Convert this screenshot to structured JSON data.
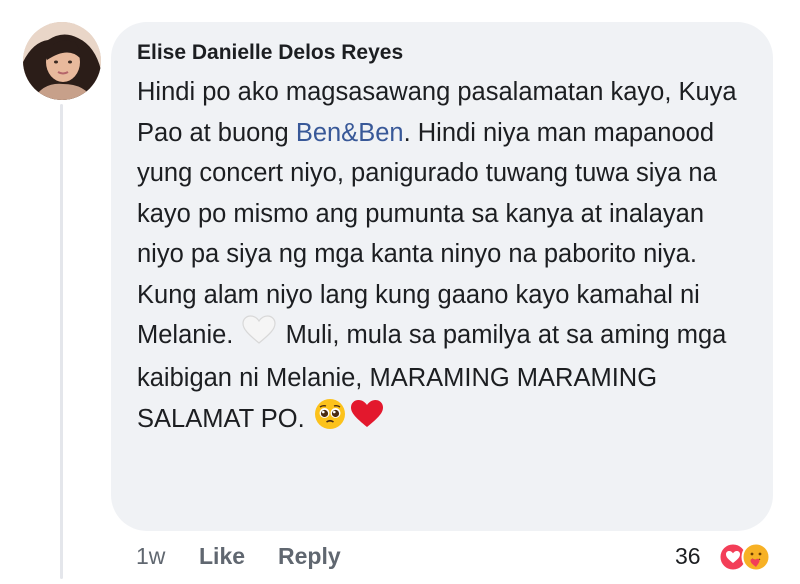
{
  "comment": {
    "author": "Elise Danielle Delos Reyes",
    "text_before_link": "Hindi po ako magsasawang pasalamatan kayo, Kuya Pao at buong ",
    "link_text": "Ben&Ben",
    "text_after_link": ". Hindi niya man mapanood yung concert niyo, panigurado tuwang tuwa siya na kayo po mismo ang pumunta sa kanya at inalayan niyo pa siya ng mga kanta ninyo na paborito niya. Kung alam niyo lang kung gaano kayo kamahal ni Melanie. ",
    "text_after_heart": " Muli, mula sa pamilya at sa aming mga kaibigan ni Melanie, MARAMING MARAMING SALAMAT PO. ",
    "emojis": [
      "white-heart",
      "pleading-face",
      "red-heart"
    ]
  },
  "footer": {
    "time": "1w",
    "like_label": "Like",
    "reply_label": "Reply",
    "reaction_count": "36",
    "reaction_icons": [
      "love-reaction",
      "care-reaction"
    ]
  },
  "colors": {
    "bubble": "#f0f2f5",
    "link": "#385898",
    "love": "#f33e58",
    "care": "#f7b125"
  }
}
